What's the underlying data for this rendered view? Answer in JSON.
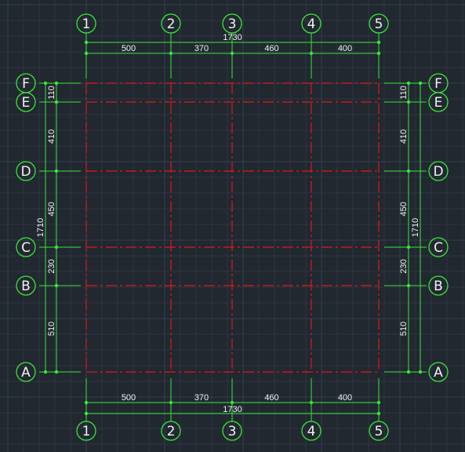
{
  "drawing": {
    "background_color": "#212830",
    "axis_color": "#e01818",
    "dimension_color": "#39e639",
    "text_color": "#f2f2f2"
  },
  "columns": {
    "labels": [
      "1",
      "2",
      "3",
      "4",
      "5"
    ],
    "spacings": [
      "500",
      "370",
      "460",
      "400"
    ],
    "total": "1730"
  },
  "rows": {
    "labels": [
      "A",
      "B",
      "C",
      "D",
      "E",
      "F"
    ],
    "spacings_bottom_to_top": [
      "510",
      "230",
      "450",
      "410",
      "110"
    ],
    "total": "1710"
  }
}
